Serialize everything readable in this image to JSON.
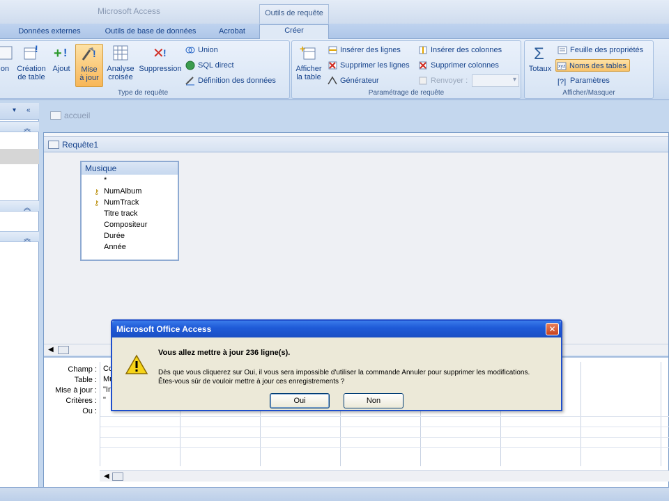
{
  "window": {
    "title": "Microsoft Access",
    "context_tab_group": "Outils de requête"
  },
  "tabs": [
    {
      "label": "Données externes"
    },
    {
      "label": "Outils de base de données"
    },
    {
      "label": "Acrobat"
    },
    {
      "label": "Créer",
      "active": true
    }
  ],
  "ribbon": {
    "type_requete": {
      "label": "Type de requête",
      "buttons": [
        {
          "label1": "on",
          "label2": ""
        },
        {
          "label1": "Création",
          "label2": "de table"
        },
        {
          "label1": "Ajout",
          "label2": ""
        },
        {
          "label1": "Mise",
          "label2": "à jour",
          "pressed": true
        },
        {
          "label1": "Analyse",
          "label2": "croisée"
        },
        {
          "label1": "Suppression",
          "label2": ""
        }
      ],
      "small": [
        "Union",
        "SQL direct",
        "Définition des données"
      ]
    },
    "parametrage": {
      "label": "Paramétrage de requête",
      "afficher_table": {
        "label1": "Afficher",
        "label2": "la table"
      },
      "small": [
        "Insérer des lignes",
        "Supprimer les lignes",
        "Générateur",
        "Insérer des colonnes",
        "Supprimer colonnes",
        "Renvoyer :"
      ]
    },
    "afficher_masquer": {
      "label": "Afficher/Masquer",
      "totaux": "Totaux",
      "small": [
        "Feuille des propriétés",
        "Noms des tables",
        "Paramètres"
      ]
    }
  },
  "nav": {
    "dropdown": "▾",
    "collapse": "«",
    "chevron": "≈"
  },
  "doc": {
    "tab_accueil": "accueil",
    "query_title": "Requête1",
    "table": {
      "name": "Musique",
      "fields": [
        {
          "name": "*",
          "key": false
        },
        {
          "name": "NumAlbum",
          "key": true
        },
        {
          "name": "NumTrack",
          "key": true
        },
        {
          "name": "Titre track",
          "key": false
        },
        {
          "name": "Compositeur",
          "key": false
        },
        {
          "name": "Durée",
          "key": false
        },
        {
          "name": "Année",
          "key": false
        }
      ]
    },
    "grid": {
      "row_labels": [
        "Champ :",
        "Table :",
        "Mise à jour :",
        "Critères :",
        "Ou :"
      ],
      "first_col": [
        "Co",
        "Mu",
        "\"In",
        "\""
      ]
    }
  },
  "dialog": {
    "title": "Microsoft Office Access",
    "close": "✕",
    "message_bold": "Vous allez mettre à jour 236 ligne(s).",
    "message_line1": "Dès que vous cliquerez sur Oui, il vous sera impossible d'utiliser la commande Annuler pour supprimer les modifications.",
    "message_line2": "Êtes-vous sûr de vouloir mettre à jour ces enregistrements ?",
    "yes": "Oui",
    "no": "Non"
  }
}
